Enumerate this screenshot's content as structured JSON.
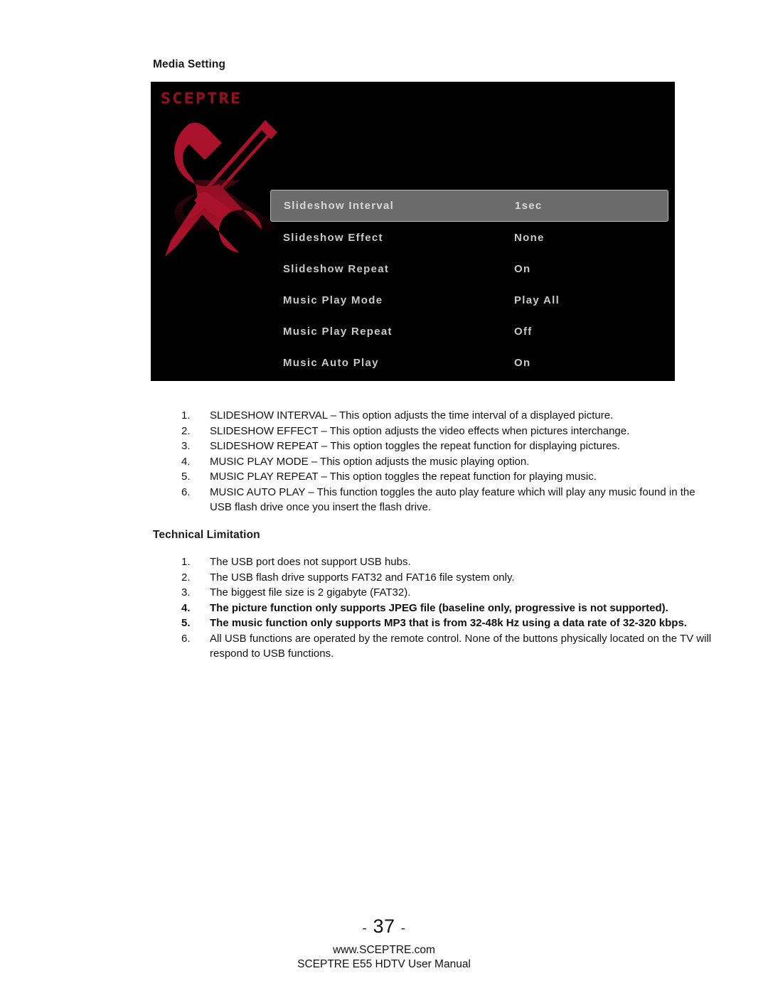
{
  "headings": {
    "media_setting": "Media Setting",
    "technical_limitation": "Technical Limitation"
  },
  "osd": {
    "brand_logo": "SCEPTRE",
    "tools_icon": "wrench-screwdriver-icon",
    "logo_color": "#8e1320",
    "icon_color": "#a9122a",
    "highlight_color": "#6b6b6b",
    "text_color": "#c9c9c9",
    "rows": [
      {
        "label": "Slideshow Interval",
        "value": "1sec",
        "selected": true
      },
      {
        "label": "Slideshow Effect",
        "value": "None",
        "selected": false
      },
      {
        "label": "Slideshow Repeat",
        "value": "On",
        "selected": false
      },
      {
        "label": "Music Play Mode",
        "value": "Play All",
        "selected": false
      },
      {
        "label": "Music Play Repeat",
        "value": "Off",
        "selected": false
      },
      {
        "label": "Music Auto Play",
        "value": "On",
        "selected": false
      }
    ]
  },
  "media_list": [
    {
      "num": "1.",
      "text": "SLIDESHOW INTERVAL – This option adjusts the time interval of a displayed picture.",
      "bold": false
    },
    {
      "num": "2.",
      "text": "SLIDESHOW EFFECT – This option adjusts the video effects when pictures interchange.",
      "bold": false
    },
    {
      "num": "3.",
      "text": "SLIDESHOW REPEAT – This option toggles the repeat function for displaying pictures.",
      "bold": false
    },
    {
      "num": "4.",
      "text": "MUSIC PLAY MODE – This option adjusts the music playing option.",
      "bold": false
    },
    {
      "num": "5.",
      "text": "MUSIC PLAY REPEAT – This option toggles the repeat function for playing music.",
      "bold": false
    },
    {
      "num": "6.",
      "text": "MUSIC AUTO PLAY – This function toggles the auto play feature which will play any music found in the USB flash drive once you insert the flash drive.",
      "bold": false
    }
  ],
  "tech_list": [
    {
      "num": "1.",
      "text": "The USB port does not support USB hubs.",
      "bold": false
    },
    {
      "num": "2.",
      "text": "The USB flash drive supports FAT32 and FAT16 file system only.",
      "bold": false
    },
    {
      "num": "3.",
      "text": "The biggest file size is 2 gigabyte (FAT32).",
      "bold": false
    },
    {
      "num": "4.",
      "text": "The picture function only supports JPEG file (baseline only, progressive is not supported).",
      "bold": true
    },
    {
      "num": "5.",
      "text": "The music function only supports MP3 that is from 32-48k Hz using a data rate of 32-320 kbps.",
      "bold": true
    },
    {
      "num": "6.",
      "text": "All USB functions are operated by the remote control.  None of the buttons physically located on the TV will respond to USB functions.",
      "bold": false
    }
  ],
  "footer": {
    "page_number": "37",
    "dash_left": "-",
    "dash_right": "-",
    "url": "www.SCEPTRE.com",
    "manual": "SCEPTRE E55 HDTV User Manual"
  }
}
